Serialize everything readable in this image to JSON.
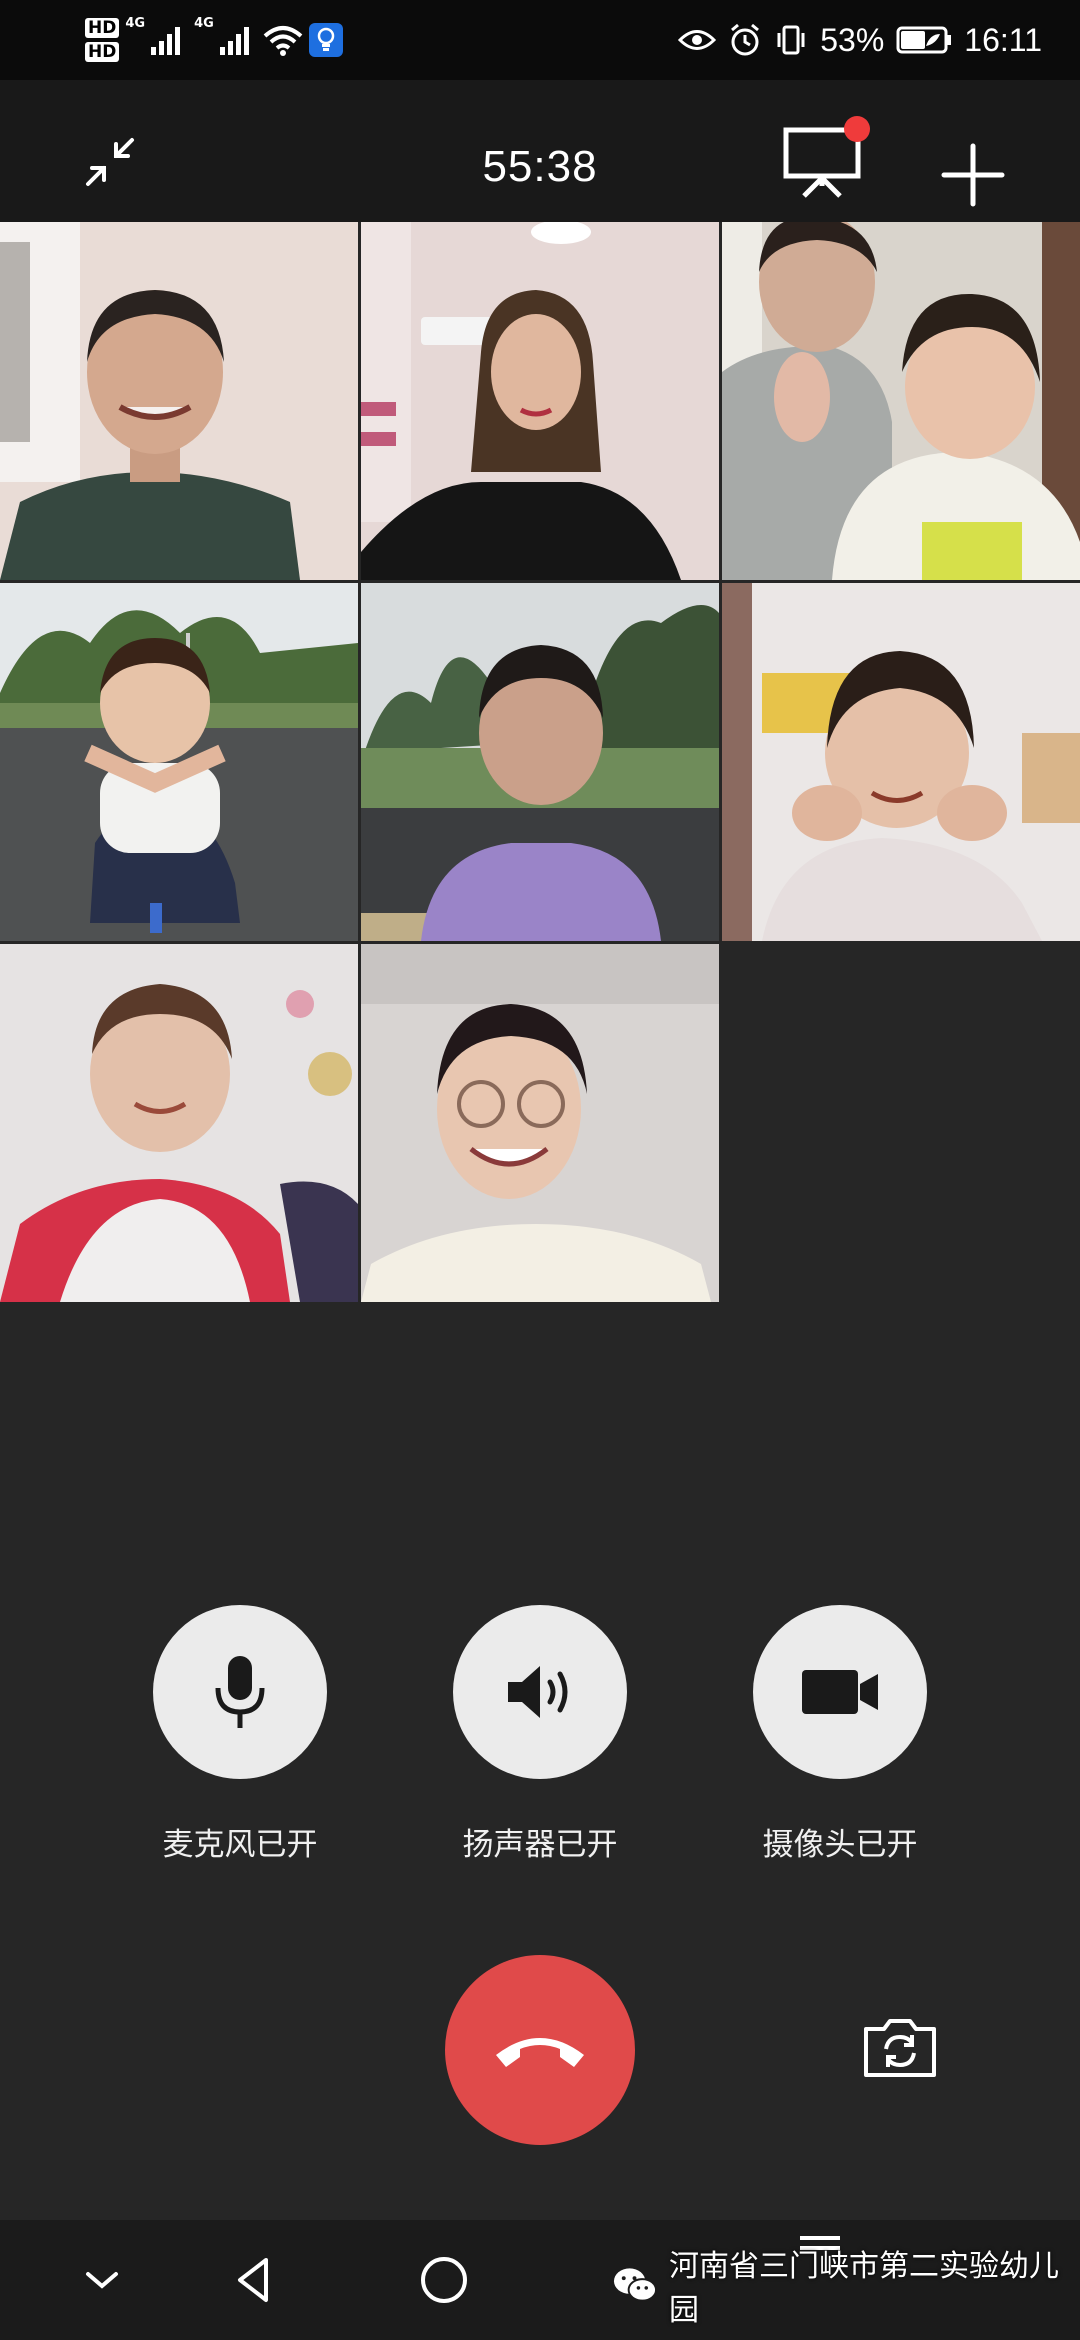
{
  "status_bar": {
    "hd1": "HD",
    "hd2": "HD",
    "net1": "4G",
    "net2": "4G",
    "battery": "53%",
    "time": "16:11",
    "icons": [
      "hd-icon",
      "signal-icon",
      "wifi-icon",
      "bulb-icon",
      "eye-icon",
      "alarm-icon",
      "vibrate-icon",
      "battery-icon"
    ]
  },
  "call": {
    "duration": "55:38",
    "whiteboard_badge_color": "#ef3b3b"
  },
  "participants": [
    {
      "name": "participant-1",
      "tone": "#cdbfb5"
    },
    {
      "name": "participant-2",
      "tone": "#d8c8c4"
    },
    {
      "name": "participant-3",
      "tone": "#c9c2b8"
    },
    {
      "name": "participant-4",
      "tone": "#8f9a88"
    },
    {
      "name": "participant-5",
      "tone": "#7d8a73"
    },
    {
      "name": "participant-6",
      "tone": "#cfc6c3"
    },
    {
      "name": "participant-7",
      "tone": "#dcd6d6"
    },
    {
      "name": "participant-8",
      "tone": "#c8c2bd"
    }
  ],
  "controls": {
    "mic_label": "麦克风已开",
    "speaker_label": "扬声器已开",
    "camera_label": "摄像头已开"
  },
  "colors": {
    "hangup": "#e04a4a",
    "control_circle": "#ebebeb",
    "background": "#262626"
  },
  "watermark": {
    "text": "河南省三门峡市第二实验幼儿园"
  }
}
